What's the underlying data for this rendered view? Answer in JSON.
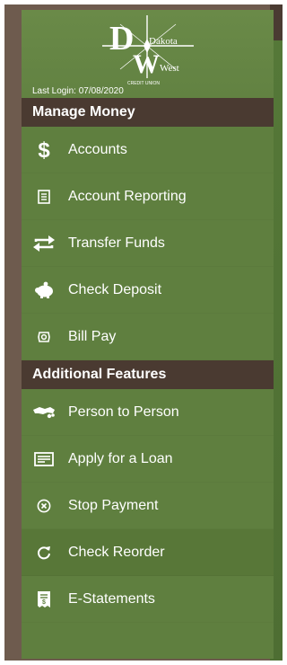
{
  "brand": {
    "logo_text_primary": "Dakota",
    "logo_text_secondary": "West",
    "logo_subtext": "CREDIT UNION"
  },
  "last_login": "Last Login: 07/08/2020",
  "sections": [
    {
      "title": "Manage Money",
      "items": [
        {
          "label": "Accounts",
          "icon": "dollar-icon"
        },
        {
          "label": "Account Reporting",
          "icon": "report-icon"
        },
        {
          "label": "Transfer Funds",
          "icon": "transfer-icon"
        },
        {
          "label": "Check Deposit",
          "icon": "piggy-bank-icon"
        },
        {
          "label": "Bill Pay",
          "icon": "bill-pay-icon"
        }
      ]
    },
    {
      "title": "Additional Features",
      "items": [
        {
          "label": "Person to Person",
          "icon": "handshake-icon"
        },
        {
          "label": "Apply for a Loan",
          "icon": "loan-card-icon"
        },
        {
          "label": "Stop Payment",
          "icon": "stop-circle-icon"
        },
        {
          "label": "Check Reorder",
          "icon": "refresh-icon",
          "active": true
        },
        {
          "label": "E-Statements",
          "icon": "statement-icon"
        }
      ]
    }
  ],
  "colors": {
    "panel": "#5f7f3f",
    "header": "#4a3a31",
    "frame": "#6e5b4e",
    "active_item": "#587738"
  }
}
